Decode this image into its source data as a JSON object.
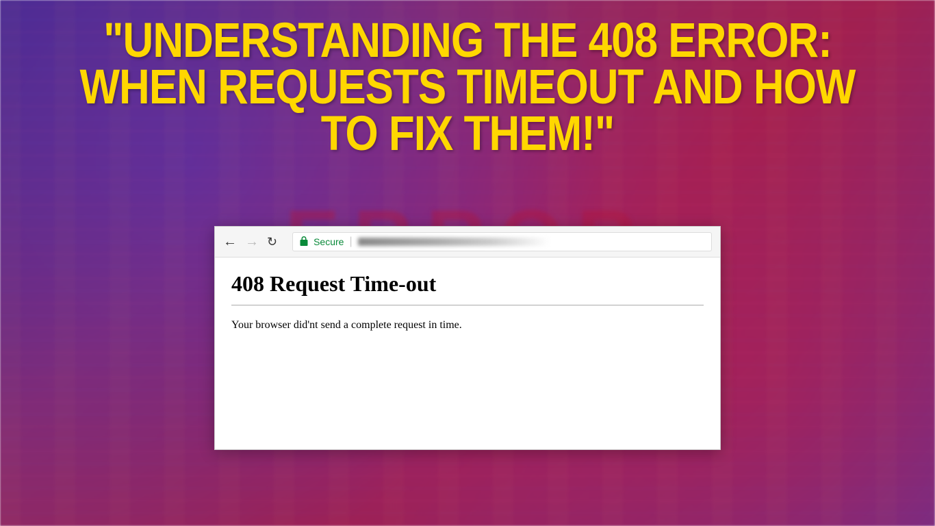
{
  "headline": {
    "text": "\"UNDERSTANDING THE 408 ERROR: WHEN REQUESTS TIMEOUT AND HOW TO FIX THEM!\""
  },
  "background": {
    "error_label": "ERROR"
  },
  "browser": {
    "secure_label": "Secure",
    "content": {
      "heading": "408 Request Time-out",
      "message": "Your browser did'nt send a complete request in time."
    }
  }
}
